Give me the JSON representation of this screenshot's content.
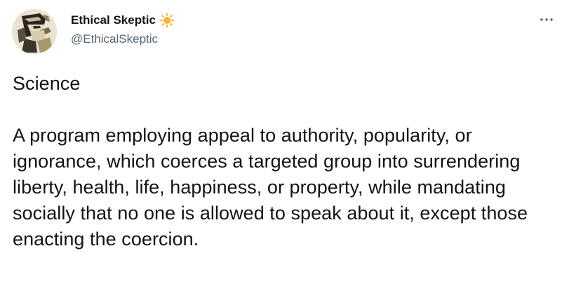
{
  "author": {
    "display_name": "Ethical Skeptic",
    "handle": "@EthicalSkeptic",
    "badge_icon": "sun-icon",
    "badge_color": "#f5a623"
  },
  "menu": {
    "icon": "more-horizontal-icon"
  },
  "tweet": {
    "paragraph_1": "Science",
    "paragraph_2": "A program employing appeal to authority, popularity, or ignorance, which coerces a targeted group into surrendering liberty, health, life, happiness, or property, while mandating socially that no one is allowed to speak about it, except those enacting the coercion."
  },
  "colors": {
    "text_primary": "#0f1419",
    "text_secondary": "#536471",
    "background": "#ffffff"
  }
}
